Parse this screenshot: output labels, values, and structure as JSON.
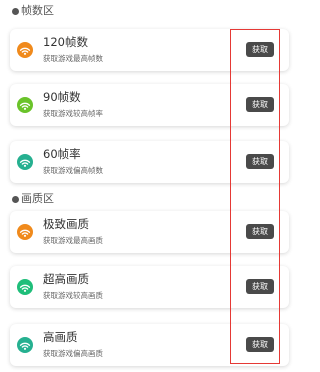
{
  "sections": [
    {
      "title": "帧数区",
      "items": [
        {
          "name": "120帧数",
          "desc": "获取游戏最高帧数",
          "button": "获取",
          "icon": "wifi-icon",
          "color": "#f08a1c"
        },
        {
          "name": "90帧数",
          "desc": "获取游戏较高帧率",
          "button": "获取",
          "icon": "wifi-icon",
          "color": "#6ac32a"
        },
        {
          "name": "60帧率",
          "desc": "获取游戏偏高帧数",
          "button": "获取",
          "icon": "wifi-icon",
          "color": "#26b090"
        }
      ]
    },
    {
      "title": "画质区",
      "items": [
        {
          "name": "极致画质",
          "desc": "获取游戏最高画质",
          "button": "获取",
          "icon": "wifi-icon",
          "color": "#f08a1c"
        },
        {
          "name": "超高画质",
          "desc": "获取游戏较高画质",
          "button": "获取",
          "icon": "wifi-icon",
          "color": "#1fbe7a"
        },
        {
          "name": "高画质",
          "desc": "获取游戏偏高画质",
          "button": "获取",
          "icon": "wifi-icon",
          "color": "#26b090"
        }
      ]
    }
  ],
  "colors": {
    "button_bg": "#4a4a4a",
    "highlight": "#e53935"
  }
}
